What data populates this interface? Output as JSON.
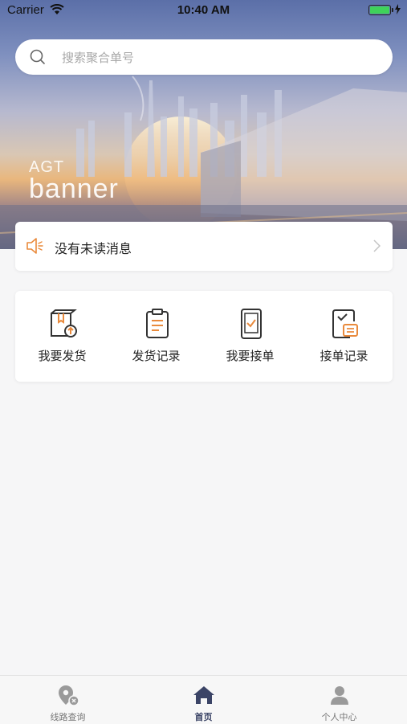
{
  "status_bar": {
    "carrier": "Carrier",
    "time": "10:40 AM"
  },
  "search": {
    "placeholder": "搜索聚合单号"
  },
  "banner": {
    "small_text": "AGT",
    "large_text": "banner"
  },
  "notice": {
    "text": "没有未读消息"
  },
  "quick_actions": [
    {
      "label": "我要发货",
      "icon": "ship-package-icon"
    },
    {
      "label": "发货记录",
      "icon": "clipboard-list-icon"
    },
    {
      "label": "我要接单",
      "icon": "phone-check-icon"
    },
    {
      "label": "接单记录",
      "icon": "order-record-icon"
    }
  ],
  "tabs": [
    {
      "label": "线路查询",
      "icon": "route-map-icon",
      "active": false
    },
    {
      "label": "首页",
      "icon": "home-icon",
      "active": true
    },
    {
      "label": "个人中心",
      "icon": "user-icon",
      "active": false
    }
  ],
  "colors": {
    "accent": "#e98a3c",
    "tab_active": "#3b4466",
    "tab_inactive": "#9a9a9a"
  }
}
